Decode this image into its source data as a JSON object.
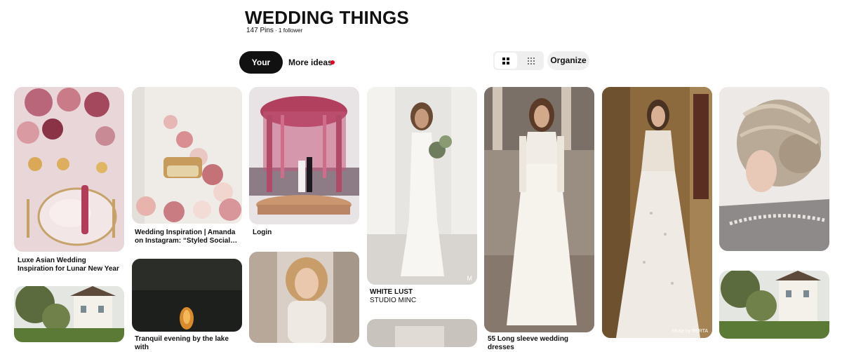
{
  "board": {
    "title": "WEDDING THINGS",
    "pins_count": "147 Pins",
    "separator": " · ",
    "followers": "1 follower"
  },
  "tabs": {
    "your_pins": "Your Pins",
    "more_ideas": "More ideas"
  },
  "toolbar": {
    "organize_label": "Organize",
    "view_default_icon": "grid-4-icon",
    "view_dense_icon": "grid-9-icon"
  },
  "colors": {
    "accent": "#e60023",
    "active_pill": "#111111",
    "control_bg": "#efefef"
  },
  "pins": [
    {
      "title": "Luxe Asian Wedding Inspiration for Lunar New Year"
    },
    {
      "title": "Wedding Inspiration | Amanda on Instagram: “Styled Social…"
    },
    {
      "title": "Login"
    },
    {
      "title": "WHITE LUST",
      "subtitle": "STUDIO MINC",
      "watermark": "M"
    },
    {
      "title": "55 Long sleeve wedding dresses"
    },
    {
      "watermark": "Muse by BERTA"
    },
    {
      "title": "Tranquil evening by the lake with"
    }
  ]
}
